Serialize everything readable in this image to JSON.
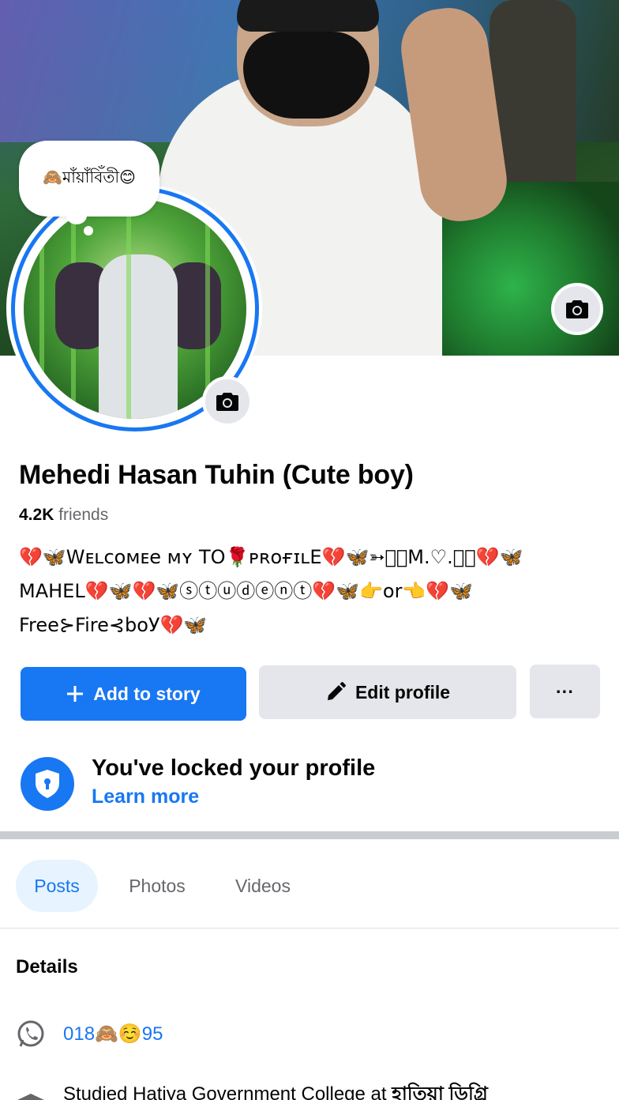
{
  "profile": {
    "note": "🙈মাঁয়াঁবিঁতী😊",
    "name": "Mehedi Hasan Tuhin (Cute boy)",
    "friends_count": "4.2K",
    "friends_label": "friends",
    "bio_line1": "💔🦋Wᴇʟᴄᴏᴍᴇe ᴍʏ TO🌹ᴘʀᴏғɪʟE💔🦋➳⃝⃞M.♡.⃝⃞💔🦋",
    "bio_line2": "MAHEL💔🦋💔🦋ⓢⓣⓤⓓⓔⓝⓣ💔🦋👉or👈💔🦋",
    "bio_line3": "Free⊱Fire⊰boУ💔🦋"
  },
  "actions": {
    "add_story_label": "Add to story",
    "edit_profile_label": "Edit profile",
    "more_label": "···"
  },
  "lock": {
    "title": "You've locked your profile",
    "link": "Learn more"
  },
  "tabs": [
    {
      "label": "Posts"
    },
    {
      "label": "Photos"
    },
    {
      "label": "Videos"
    }
  ],
  "details": {
    "heading": "Details",
    "phone": "018🙈☺️95",
    "education_prefix": "Studied Hatiya Government College at",
    "education_school": "হাতিয়া ডিগ্রি"
  },
  "colors": {
    "accent": "#1877f2",
    "button_gray": "#e4e6eb",
    "tab_active_bg": "#e7f3ff"
  }
}
